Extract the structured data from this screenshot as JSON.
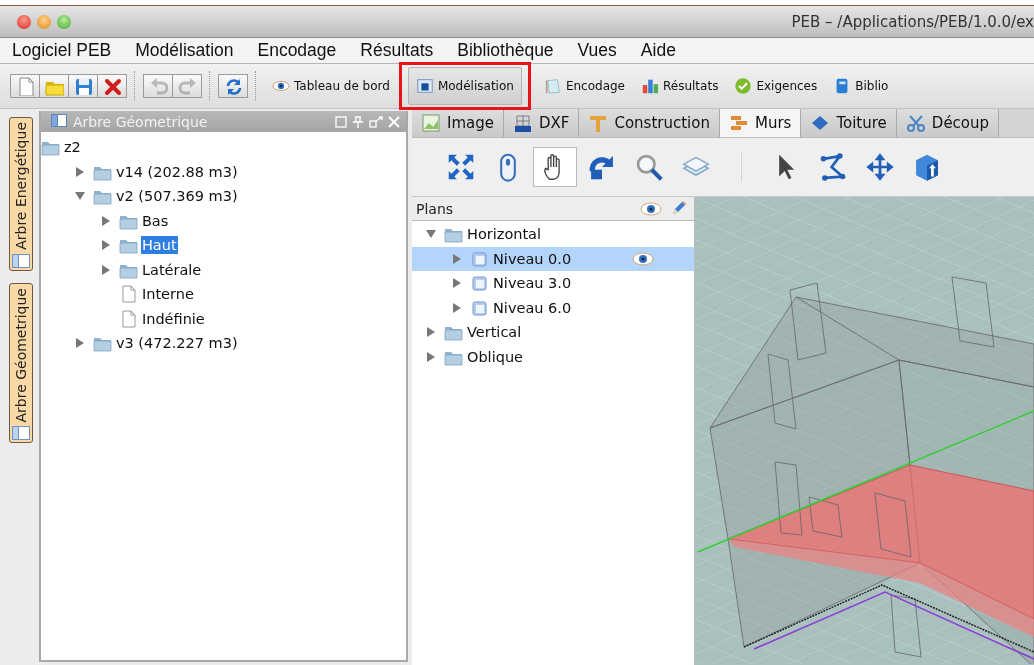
{
  "window": {
    "title": "PEB – /Applications/PEB/1.0.0/ex"
  },
  "menu": [
    "Logiciel PEB",
    "Modélisation",
    "Encodage",
    "Résultats",
    "Bibliothèque",
    "Vues",
    "Aide"
  ],
  "toolbar": {
    "tool_groups": [
      [
        {
          "kind": "new",
          "disabled": false
        },
        {
          "kind": "open",
          "disabled": false
        },
        {
          "kind": "save",
          "disabled": false
        },
        {
          "kind": "delete",
          "disabled": false
        }
      ],
      [
        {
          "kind": "undo",
          "disabled": true
        },
        {
          "kind": "redo",
          "disabled": true
        }
      ],
      [
        {
          "kind": "refresh",
          "disabled": false
        }
      ]
    ],
    "views": [
      {
        "label": "Tableau de bord",
        "kind": "dashboard",
        "selected": false,
        "highlighted": false
      },
      {
        "label": "Modélisation",
        "kind": "modeling",
        "selected": true,
        "highlighted": true
      },
      {
        "label": "Encodage",
        "kind": "encoding",
        "selected": false,
        "highlighted": false
      },
      {
        "label": "Résultats",
        "kind": "results",
        "selected": false,
        "highlighted": false
      },
      {
        "label": "Exigences",
        "kind": "requirements",
        "selected": false,
        "highlighted": false
      },
      {
        "label": "Biblio",
        "kind": "library",
        "selected": false,
        "highlighted": false
      }
    ]
  },
  "side_tabs": [
    "Arbre Energétique",
    "Arbre Géometrique"
  ],
  "geometry_panel": {
    "title": "Arbre Géometrique",
    "tree": [
      {
        "label": "z2",
        "kind": "folder",
        "selected": false,
        "children": [
          {
            "label": "v14 (202.88 m3)",
            "kind": "folder",
            "expanded": false,
            "selected": false
          },
          {
            "label": "v2 (507.369 m3)",
            "kind": "folder",
            "expanded": true,
            "selected": false,
            "children": [
              {
                "label": "Bas",
                "kind": "folder",
                "expanded": false,
                "selected": false
              },
              {
                "label": "Haut",
                "kind": "folder",
                "expanded": false,
                "selected": true
              },
              {
                "label": "Latérale",
                "kind": "folder",
                "expanded": false,
                "selected": false
              },
              {
                "label": "Interne",
                "kind": "file",
                "selected": false
              },
              {
                "label": "Indéfinie",
                "kind": "file",
                "selected": false
              }
            ]
          },
          {
            "label": "v3 (472.227 m3)",
            "kind": "folder",
            "expanded": false,
            "selected": false
          }
        ]
      }
    ]
  },
  "tabs": [
    {
      "label": "Image",
      "kind": "image",
      "selected": false
    },
    {
      "label": "DXF",
      "kind": "dxf",
      "selected": false
    },
    {
      "label": "Construction",
      "kind": "construction",
      "selected": false
    },
    {
      "label": "Murs",
      "kind": "walls",
      "selected": true
    },
    {
      "label": "Toiture",
      "kind": "roof",
      "selected": false
    },
    {
      "label": "Découp",
      "kind": "cut",
      "selected": false
    }
  ],
  "view_tool_groups": [
    [
      {
        "kind": "fit",
        "selected": false
      },
      {
        "kind": "mouse",
        "selected": false
      },
      {
        "kind": "hand",
        "selected": true
      },
      {
        "kind": "rotate",
        "selected": false
      },
      {
        "kind": "zoom",
        "selected": false
      },
      {
        "kind": "layers",
        "selected": false
      }
    ],
    [
      {
        "kind": "pointer",
        "selected": false
      },
      {
        "kind": "polyline",
        "selected": false
      },
      {
        "kind": "move",
        "selected": false
      },
      {
        "kind": "extrude",
        "selected": false
      }
    ]
  ],
  "plans_panel": {
    "title": "Plans",
    "tree": [
      {
        "label": "Horizontal",
        "kind": "folder",
        "expanded": true,
        "selected": false,
        "visible": false,
        "children": [
          {
            "label": "Niveau 0.0",
            "kind": "level",
            "expanded": false,
            "selected": true,
            "visible": true
          },
          {
            "label": "Niveau 3.0",
            "kind": "level",
            "expanded": false,
            "selected": false,
            "visible": false
          },
          {
            "label": "Niveau 6.0",
            "kind": "level",
            "expanded": false,
            "selected": false,
            "visible": false
          }
        ]
      },
      {
        "label": "Vertical",
        "kind": "folder",
        "expanded": false,
        "selected": false,
        "visible": false
      },
      {
        "label": "Oblique",
        "kind": "folder",
        "expanded": false,
        "selected": false,
        "visible": false
      }
    ]
  }
}
